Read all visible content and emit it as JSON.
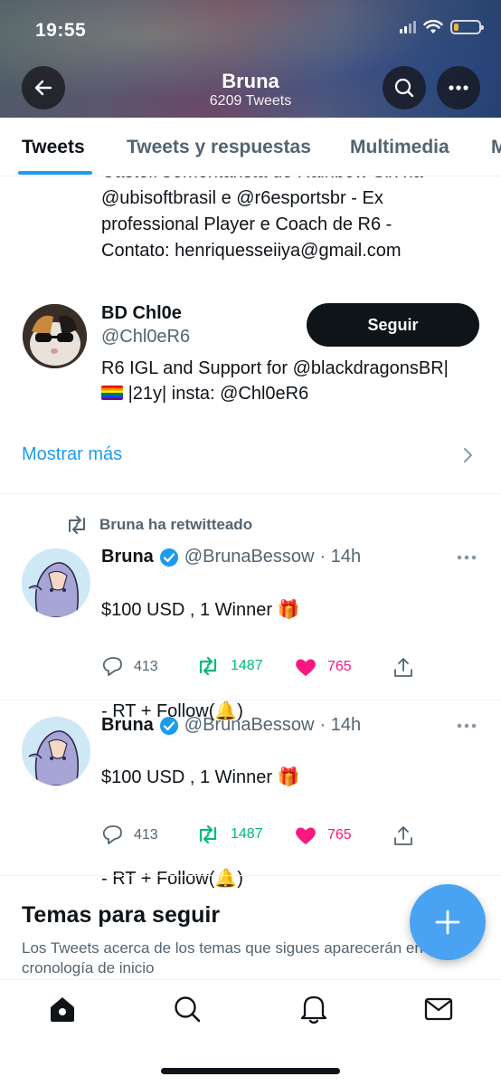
{
  "status_bar": {
    "time": "19:55",
    "icons": [
      "signal-icon",
      "wifi-icon",
      "battery-icon"
    ],
    "battery_color": "#f0b53a"
  },
  "header": {
    "name": "Bruna",
    "tweet_count": "6209 Tweets",
    "icons": [
      "back-arrow-icon",
      "search-icon",
      "more-icon"
    ]
  },
  "tabs": [
    {
      "label": "Tweets",
      "active": true
    },
    {
      "label": "Tweets y respuestas",
      "active": false
    },
    {
      "label": "Multimedia",
      "active": false
    },
    {
      "label": "M",
      "active": false
    }
  ],
  "bio_continuation": {
    "line1": "Caster/Comentarista de Rainbow Six na",
    "line2": "@ubisoftbrasil e @r6esportsbr - Ex",
    "line3": "professional Player e Coach de R6 -",
    "line4": "Contato: henriquesseiiya@gmail.com"
  },
  "follow_suggestion": {
    "name": "BD Chl0e",
    "handle": "@Chl0eR6",
    "button_label": "Seguir",
    "bio_line1": "R6 IGL and Support for @blackdragonsBR|",
    "bio_line2_after_flag": "|21y| insta: @Chl0eR6"
  },
  "show_more_label": "Mostrar más",
  "tweets": [
    {
      "retweet_label": "Bruna ha retwitteado",
      "name": "Bruna",
      "verified": true,
      "handle": "@BrunaBessow",
      "time": "· 14h",
      "line1": "$100 USD , 1 Winner 🎁",
      "line2": "- RT + Follow(🔔)",
      "replies": "413",
      "retweets": "1487",
      "likes": "765"
    },
    {
      "retweet_label": "",
      "name": "Bruna",
      "verified": true,
      "handle": "@BrunaBessow",
      "time": "· 14h",
      "line1": "$100 USD , 1 Winner 🎁",
      "line2": "- RT + Follow(🔔)",
      "replies": "413",
      "retweets": "1487",
      "likes": "765"
    }
  ],
  "topics": {
    "title": "Temas para seguir",
    "description": "Los Tweets acerca de los temas que sigues aparecerán en tu cronología de inicio"
  },
  "bottom_nav": [
    "home-icon",
    "search-icon",
    "notifications-icon",
    "messages-icon"
  ],
  "colors": {
    "accent": "#1d9bf0",
    "retweet": "#00ba7c",
    "like": "#f91880",
    "fab": "#4aa3f2"
  }
}
